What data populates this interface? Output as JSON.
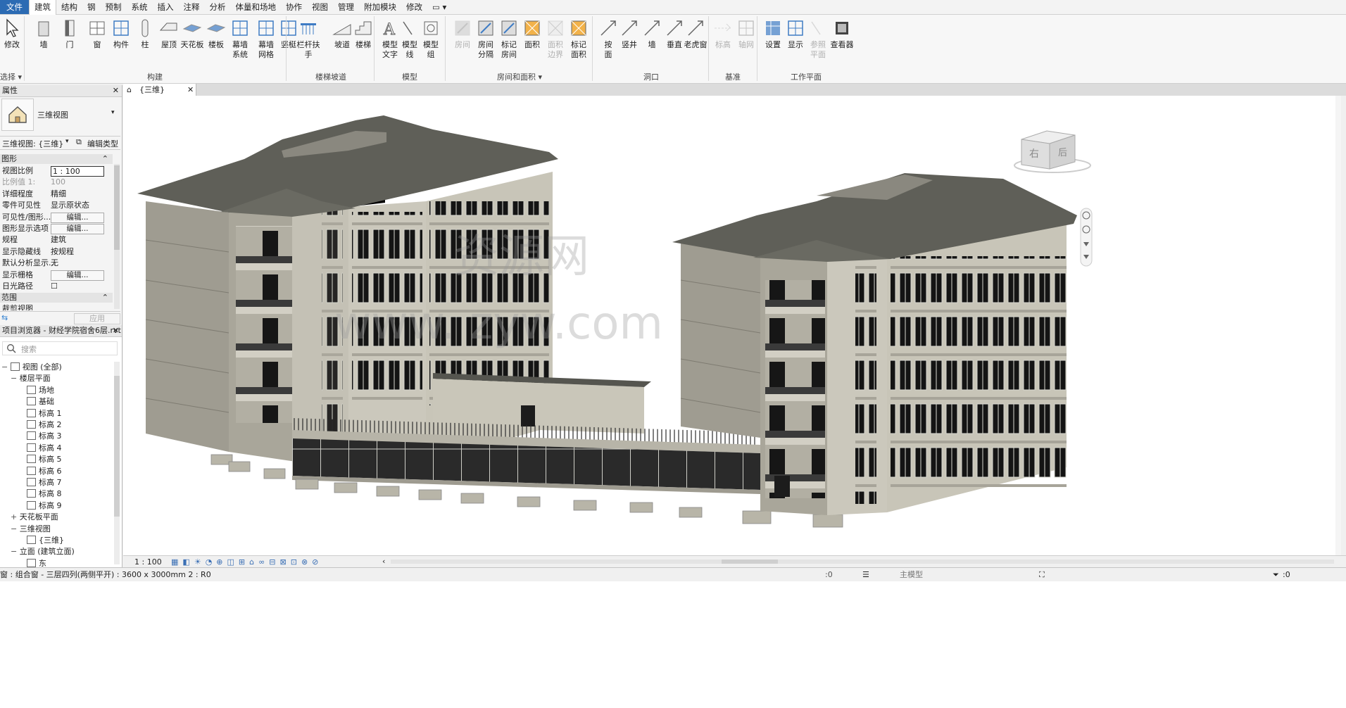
{
  "menu": {
    "tabs": [
      "文件",
      "建筑",
      "结构",
      "钢",
      "预制",
      "系统",
      "插入",
      "注释",
      "分析",
      "体量和场地",
      "协作",
      "视图",
      "管理",
      "附加模块",
      "修改"
    ],
    "active": "建筑"
  },
  "ribbon": {
    "modify": {
      "label": "修改",
      "panel": "选择"
    },
    "build": {
      "items": [
        "墙",
        "门",
        "窗",
        "构件",
        "柱",
        "屋顶",
        "天花板",
        "楼板",
        "幕墙\n系统",
        "幕墙\n网格",
        "竖梃"
      ],
      "panel": "构建"
    },
    "stairs": {
      "items": [
        "栏杆扶手",
        "坡道",
        "楼梯"
      ],
      "panel": "楼梯坡道"
    },
    "model": {
      "items": [
        "模型\n文字",
        "模型\n线",
        "模型\n组"
      ],
      "panel": "模型"
    },
    "rooms": {
      "items": [
        "房间",
        "房间\n分隔",
        "标记\n房间",
        "面积",
        "面积\n边界",
        "标记\n面积"
      ],
      "panel": "房间和面积"
    },
    "opening": {
      "items": [
        "按\n面",
        "竖井",
        "墙",
        "垂直",
        "老虎窗"
      ],
      "panel": "洞口"
    },
    "datum": {
      "items": [
        "标高",
        "轴网"
      ],
      "panel": "基准"
    },
    "workplane": {
      "items": [
        "设置",
        "显示",
        "参照\n平面",
        "查看器"
      ],
      "panel": "工作平面"
    }
  },
  "properties": {
    "title": "属性",
    "type_name": "三维视图",
    "selector": "三维视图: {三维}",
    "edit_type": "编辑类型",
    "section_graphics": "图形",
    "rows": [
      {
        "k": "视图比例",
        "v": "1 : 100",
        "input": true
      },
      {
        "k": "比例值 1:",
        "v": "100",
        "dim": true
      },
      {
        "k": "详细程度",
        "v": "精细"
      },
      {
        "k": "零件可见性",
        "v": "显示原状态"
      },
      {
        "k": "可见性/图形...",
        "v": "编辑...",
        "button": true
      },
      {
        "k": "图形显示选项",
        "v": "编辑...",
        "button": true
      },
      {
        "k": "规程",
        "v": "建筑"
      },
      {
        "k": "显示隐藏线",
        "v": "按规程"
      },
      {
        "k": "默认分析显示...",
        "v": "无"
      },
      {
        "k": "显示栅格",
        "v": "编辑...",
        "button": true
      },
      {
        "k": "日光路径",
        "v": "☐"
      }
    ],
    "section_extents": "范围",
    "crop_row": "裁剪视图",
    "apply": "应用"
  },
  "browser": {
    "title": "项目浏览器 - 财经学院宿舍6层.rvt",
    "search_placeholder": "搜索",
    "tree": [
      {
        "t": "视图 (全部)",
        "lvl": 0,
        "exp": "−",
        "icon": true
      },
      {
        "t": "楼层平面",
        "lvl": 1,
        "exp": "−"
      },
      {
        "t": "场地",
        "lvl": 2,
        "icon": true
      },
      {
        "t": "基础",
        "lvl": 2,
        "icon": true
      },
      {
        "t": "标高 1",
        "lvl": 2,
        "icon": true
      },
      {
        "t": "标高 2",
        "lvl": 2,
        "icon": true
      },
      {
        "t": "标高 3",
        "lvl": 2,
        "icon": true
      },
      {
        "t": "标高 4",
        "lvl": 2,
        "icon": true
      },
      {
        "t": "标高 5",
        "lvl": 2,
        "icon": true
      },
      {
        "t": "标高 6",
        "lvl": 2,
        "icon": true
      },
      {
        "t": "标高 7",
        "lvl": 2,
        "icon": true
      },
      {
        "t": "标高 8",
        "lvl": 2,
        "icon": true
      },
      {
        "t": "标高 9",
        "lvl": 2,
        "icon": true
      },
      {
        "t": "天花板平面",
        "lvl": 1,
        "exp": "+"
      },
      {
        "t": "三维视图",
        "lvl": 1,
        "exp": "−"
      },
      {
        "t": "{三维}",
        "lvl": 2,
        "icon": true
      },
      {
        "t": "立面 (建筑立面)",
        "lvl": 1,
        "exp": "−"
      },
      {
        "t": "东",
        "lvl": 2,
        "icon": true
      }
    ]
  },
  "view": {
    "tab_label": "{三维}",
    "viewcube_left": "右",
    "viewcube_right": "后",
    "watermark_cn": "资源网",
    "watermark_url": "www.   zyw.com"
  },
  "viewbar": {
    "scale": "1 : 100"
  },
  "status": {
    "left": "窗 : 组合窗 - 三层四列(两侧平开) : 3600 x 3000mm 2 : R0",
    "sel": ":0",
    "model": "主模型",
    "filter": ":0"
  },
  "colors": {
    "file_tab": "#2c6bb3",
    "roof": "#5f5f58",
    "wall": "#bab7ab",
    "accent_blue": "#2f7fd0"
  }
}
